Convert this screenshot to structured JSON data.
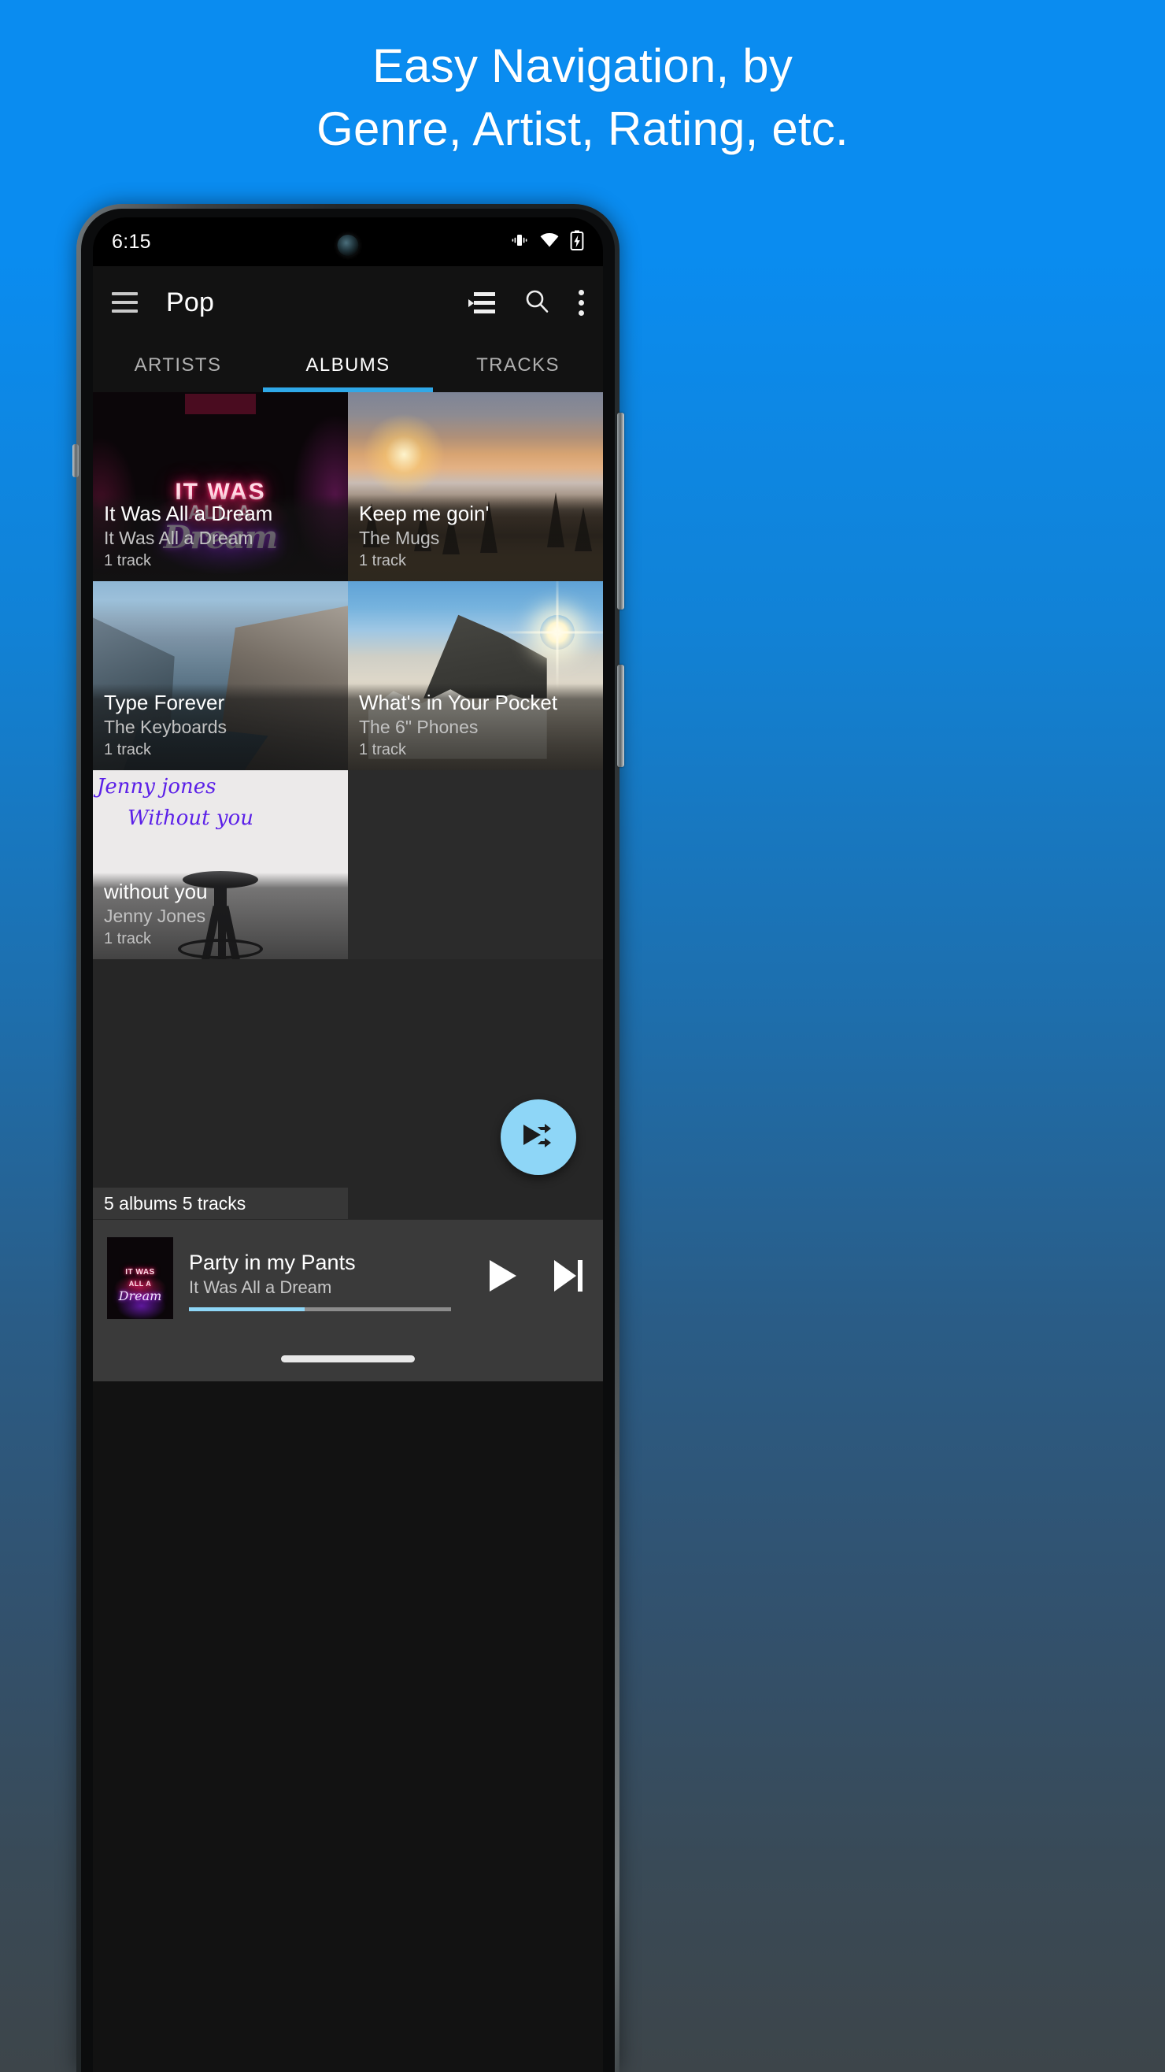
{
  "promo": {
    "line1": "Easy Navigation, by",
    "line2": "Genre, Artist, Rating, etc.",
    "bg_top_color": "#0a8cf0",
    "bg_bottom_color": "#3d454a"
  },
  "status_bar": {
    "clock": "6:15",
    "icons": [
      "vibrate-icon",
      "wifi-icon",
      "battery-charging-icon"
    ]
  },
  "app_bar": {
    "menu_icon": "hamburger-menu-icon",
    "title": "Pop",
    "actions": [
      "queue-list-icon",
      "search-icon",
      "overflow-menu-icon"
    ]
  },
  "tabs": {
    "items": [
      {
        "label": "ARTISTS",
        "active": false
      },
      {
        "label": "ALBUMS",
        "active": true
      },
      {
        "label": "TRACKS",
        "active": false
      }
    ],
    "indicator_color": "#2fa8e8"
  },
  "albums": [
    {
      "title": "It Was All a Dream",
      "artist": "It Was All a Dream",
      "count": "1 track",
      "art": "neon-sign-art"
    },
    {
      "title": "Keep me goin'",
      "artist": "The Mugs",
      "count": "1 track",
      "art": "sunset-mountain-art"
    },
    {
      "title": "Type Forever",
      "artist": "The Keyboards",
      "count": "1 track",
      "art": "fjord-cliff-art"
    },
    {
      "title": "What's in Your Pocket",
      "artist": "The 6\" Phones",
      "count": "1 track",
      "art": "snowy-ridge-art"
    },
    {
      "title": "without you",
      "artist": "Jenny Jones",
      "count": "1 track",
      "art": "stool-handwriting-art"
    }
  ],
  "album_art_text": {
    "neon_line1": "IT WAS",
    "neon_line2": "ALL A",
    "neon_line3": "Dream",
    "jenny_line1": "Jenny jones",
    "jenny_line2": "Without you"
  },
  "library_summary": "5 albums  5 tracks",
  "fab": {
    "icon": "play-shuffle-icon",
    "color": "#8ed6f7"
  },
  "player": {
    "track_title": "Party in my Pants",
    "track_album": "It Was All a Dream",
    "progress_percent": 44,
    "progress_color": "#8ed6f7",
    "play_icon": "play-icon",
    "next_icon": "skip-next-icon",
    "art_line1": "IT WAS",
    "art_line2": "ALL A",
    "art_line3": "Dream"
  },
  "nav": {
    "gesture_pill": "home-gesture-pill"
  }
}
